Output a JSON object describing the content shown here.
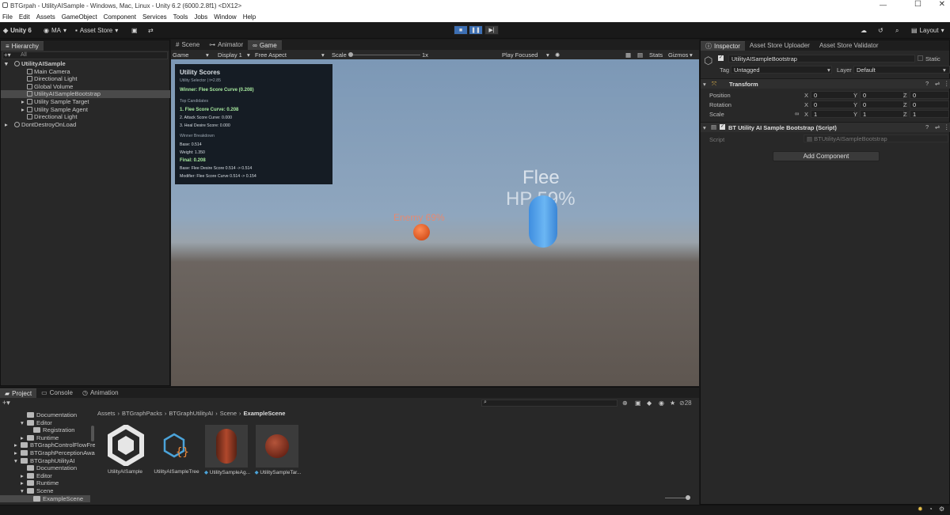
{
  "window": {
    "title": "BTGrpah - UtilityAISample - Windows, Mac, Linux - Unity 6.2 (6000.2.8f1) <DX12>"
  },
  "menu": [
    "File",
    "Edit",
    "Assets",
    "GameObject",
    "Component",
    "Services",
    "Tools",
    "Jobs",
    "Window",
    "Help"
  ],
  "toolbar": {
    "unity": "Unity 6",
    "account": "MA",
    "asset_store": "Asset Store",
    "layout": "Layout"
  },
  "hierarchy": {
    "tab": "Hierarchy",
    "search_placeholder": "All",
    "items": [
      {
        "label": "UtilityAISample"
      },
      {
        "label": "Main Camera"
      },
      {
        "label": "Directional Light"
      },
      {
        "label": "Global Volume"
      },
      {
        "label": "UtilityAISampleBootstrap"
      },
      {
        "label": "Utility Sample Target"
      },
      {
        "label": "Utility Sample Agent"
      },
      {
        "label": "Directional Light"
      },
      {
        "label": "DontDestroyOnLoad"
      }
    ]
  },
  "center_tabs": [
    "Scene",
    "Animator",
    "Game"
  ],
  "gamebar": {
    "mode": "Game",
    "display": "Display 1",
    "aspect": "Free Aspect",
    "scale_label": "Scale",
    "scale_value": "1x",
    "play_focused": "Play Focused",
    "stats": "Stats",
    "gizmos": "Gizmos"
  },
  "utility": {
    "title": "Utility Scores",
    "selector": "Utility Selector  |  t=2.85",
    "winner": "Winner: Flee Score Curve (0.208)",
    "top_candidates": "Top Candidates",
    "c1": "1. Flee Score Curve: 0.208",
    "c2": "2. Attack Score Curve: 0.000",
    "c3": "3. Heal Desire Score: 0.000",
    "breakdown": "Winner Breakdown",
    "base": "Base: 0.514",
    "weight": "Weight: 1.350",
    "final": "Final: 0.208",
    "base_line": "Base: Flee Desire Score  0.514 -> 0.514",
    "modifier_line": "Modifier: Flee Score Curve  0.514 -> 0.154"
  },
  "scene": {
    "flee": "Flee",
    "hp": "HP 59%",
    "enemy": "Enemy 69%"
  },
  "inspector": {
    "tabs": [
      "Inspector",
      "Asset Store Uploader",
      "Asset Store Validator"
    ],
    "object_name": "UtilityAISampleBootstrap",
    "static": "Static",
    "tag_label": "Tag",
    "tag": "Untagged",
    "layer_label": "Layer",
    "layer": "Default",
    "transform": "Transform",
    "position": "Position",
    "rotation": "Rotation",
    "scale": "Scale",
    "pos": [
      "0",
      "0",
      "0"
    ],
    "rot": [
      "0",
      "0",
      "0"
    ],
    "scl": [
      "1",
      "1",
      "1"
    ],
    "script_header": "BT Utility AI Sample Bootstrap (Script)",
    "script_label": "Script",
    "script_value": "BTUtilityAISampleBootstrap",
    "add_component": "Add Component"
  },
  "project": {
    "tabs": [
      "Project",
      "Console",
      "Animation"
    ],
    "breadcrumb": [
      "Assets",
      "BTGraphPacks",
      "BTGraphUtilityAI",
      "Scene",
      "ExampleScene"
    ],
    "tree": [
      "Documentation",
      "Editor",
      "Registration",
      "Runtime",
      "BTGraphControlFlowFre",
      "BTGraphPerceptionAwa",
      "BTGraphUtilityAI",
      "Documentation",
      "Editor",
      "Runtime",
      "Scene",
      "ExampleScene"
    ],
    "assets": [
      "UtilityAISample",
      "UtilityAISampleTree",
      "UtilitySampleAg...",
      "UtilitySampleTar..."
    ],
    "count": "28"
  }
}
